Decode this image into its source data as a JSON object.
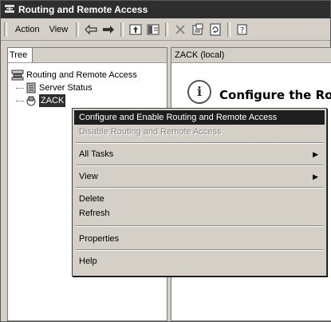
{
  "window": {
    "title": "Routing and Remote Access"
  },
  "menubar": {
    "action": "Action",
    "view": "View"
  },
  "left_pane": {
    "tab": "Tree",
    "tree": [
      {
        "label": "Routing and Remote Access"
      },
      {
        "label": "Server Status"
      },
      {
        "label": "ZACK"
      }
    ]
  },
  "right_pane": {
    "header": "ZACK (local)",
    "heading": "Configure the Rou"
  },
  "context_menu": {
    "items": [
      {
        "label": "Configure and Enable Routing and Remote Access",
        "state": "selected"
      },
      {
        "label": "Disable Routing and Remote Access",
        "state": "disabled"
      },
      {
        "label": "All Tasks",
        "submenu": true
      },
      {
        "label": "View",
        "submenu": true
      },
      {
        "label": "Delete"
      },
      {
        "label": "Refresh"
      },
      {
        "label": "Properties"
      },
      {
        "label": "Help"
      }
    ]
  }
}
